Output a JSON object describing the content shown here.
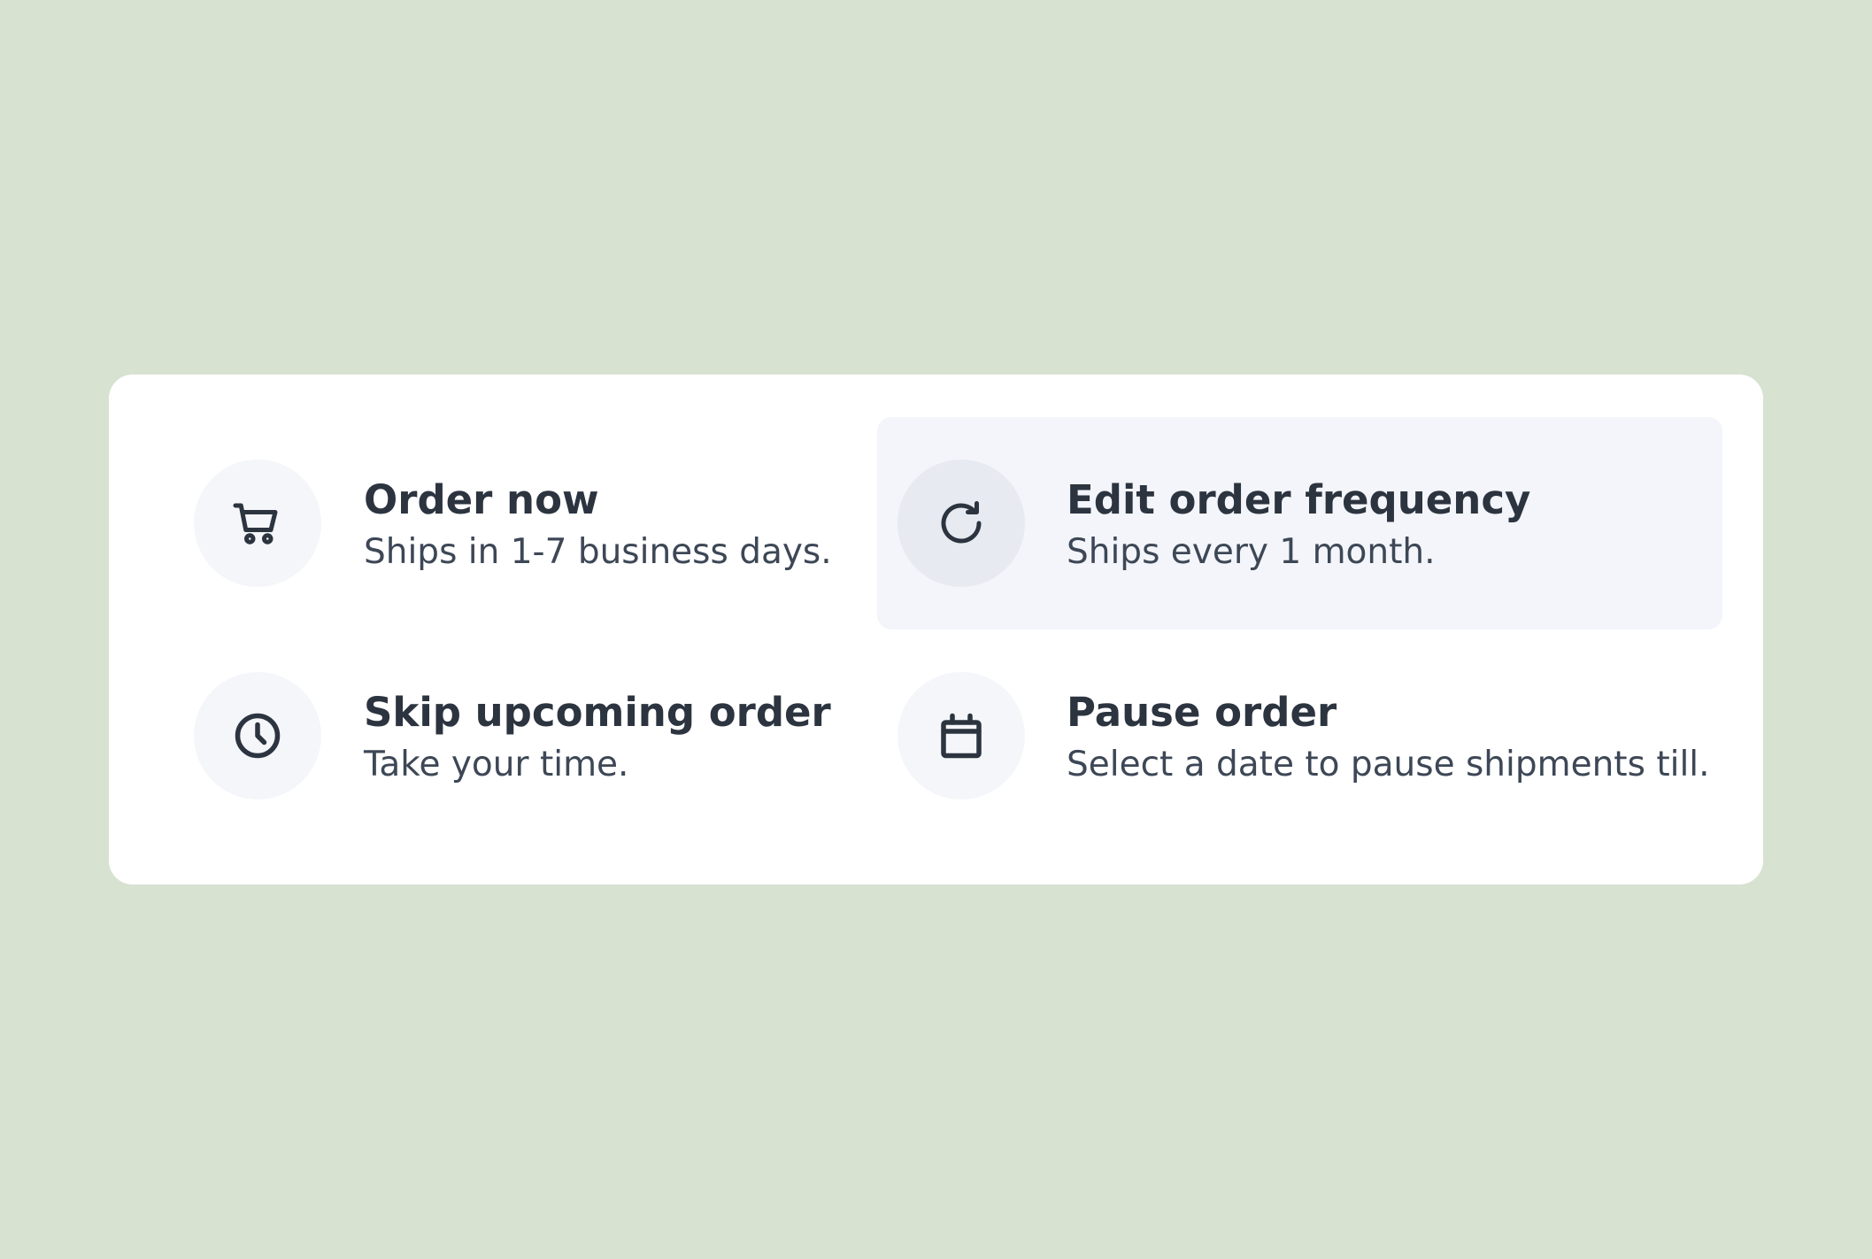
{
  "options": [
    {
      "title": "Order now",
      "subtitle": "Ships in 1-7 business days.",
      "icon": "cart-icon"
    },
    {
      "title": "Edit order frequency",
      "subtitle": "Ships every 1 month.",
      "icon": "refresh-icon",
      "highlighted": true
    },
    {
      "title": "Skip upcoming order",
      "subtitle": "Take your time.",
      "icon": "clock-icon"
    },
    {
      "title": "Pause order",
      "subtitle": "Select a date to pause shipments till.",
      "icon": "calendar-icon"
    }
  ],
  "colors": {
    "background": "#d7e2d1",
    "card": "#ffffff",
    "highlight": "#f3f5fa",
    "icon_circle": "#f4f6f9",
    "text_primary": "#2c3440",
    "text_secondary": "#3d4756"
  }
}
